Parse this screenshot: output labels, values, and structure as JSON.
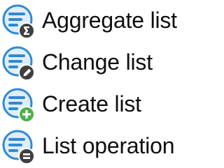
{
  "menu": {
    "items": [
      {
        "label": "Aggregate list",
        "icon": "aggregate-list-icon",
        "badge_color": "#3f3f3f",
        "badge_symbol": "sigma"
      },
      {
        "label": "Change list",
        "icon": "change-list-icon",
        "badge_color": "#3f3f3f",
        "badge_symbol": "pencil"
      },
      {
        "label": "Create list",
        "icon": "create-list-icon",
        "badge_color": "#4db04a",
        "badge_symbol": "plus"
      },
      {
        "label": "List operation",
        "icon": "list-operation-icon",
        "badge_color": "#3f3f3f",
        "badge_symbol": "equals"
      }
    ]
  },
  "colors": {
    "list_icon_fill": "#dfeef9",
    "list_icon_stroke": "#2f89d6",
    "text": "#0f0f0f"
  }
}
